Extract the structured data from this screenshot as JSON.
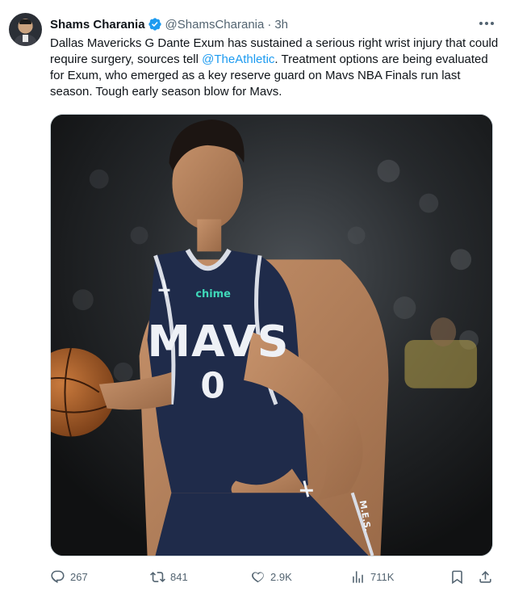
{
  "author": {
    "name": "Shams Charania",
    "handle": "@ShamsCharania",
    "separator": "·",
    "time": "3h",
    "verified_color": "#1d9bf0"
  },
  "tweet": {
    "text_before": "Dallas Mavericks G Dante Exum has sustained a serious right wrist injury that could require surgery, sources tell ",
    "mention": "@TheAthletic",
    "text_after": ". Treatment options are being evaluated for Exum, who emerged as a key reserve guard on Mavs NBA Finals run last season. Tough early season blow for Mavs."
  },
  "media": {
    "jersey_text": "MAVS",
    "jersey_number": "0",
    "sponsor": "chime",
    "shorts_text": "M.E.S."
  },
  "actions": {
    "replies": "267",
    "retweets": "841",
    "likes": "2.9K",
    "views": "711K"
  },
  "colors": {
    "accent": "#1d9bf0",
    "muted": "#536471",
    "jersey": "#1f2b4a"
  },
  "icons": [
    "more-icon",
    "verified-icon",
    "reply-icon",
    "retweet-icon",
    "like-icon",
    "views-icon",
    "bookmark-icon",
    "share-icon"
  ]
}
